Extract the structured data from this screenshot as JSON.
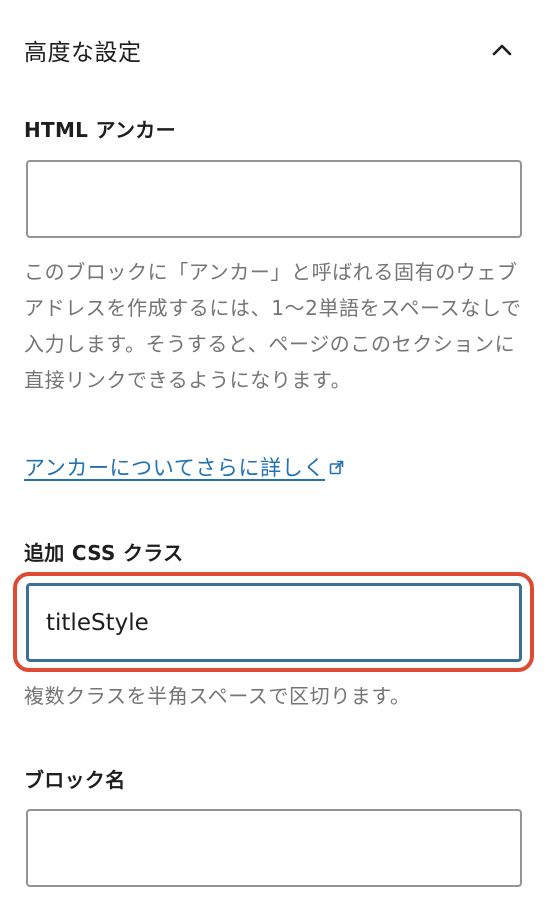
{
  "panel": {
    "title": "高度な設定",
    "toggle_icon": "chevron-up-icon"
  },
  "html_anchor": {
    "label": "HTML アンカー",
    "value": "",
    "help": "このブロックに「アンカー」と呼ばれる固有のウェブアドレスを作成するには、1〜2単語をスペースなしで入力します。そうすると、ページのこのセクションに直接リンクできるようになります。",
    "link_text": "アンカーについてさらに詳しく",
    "link_icon": "external-link-icon"
  },
  "css_class": {
    "label": "追加 CSS クラス",
    "value": "titleStyle",
    "help": "複数クラスを半角スペースで区切ります。",
    "highlight_color": "#de4a33"
  },
  "block_name": {
    "label": "ブロック名",
    "value": ""
  },
  "colors": {
    "text": "#1e1e1e",
    "help_text": "#757575",
    "link": "#2271b1",
    "focus_border": "#3a6f96",
    "input_border": "#949494"
  }
}
